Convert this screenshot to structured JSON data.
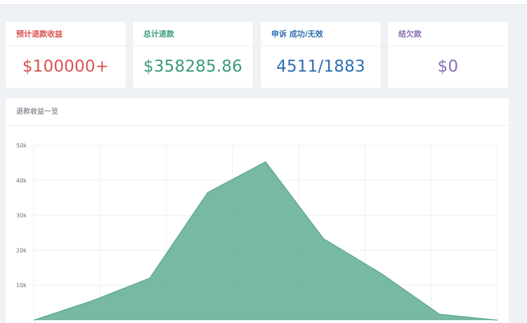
{
  "stats": [
    {
      "label": "预计退款收益",
      "value": "$100000+",
      "color": "#d9534f"
    },
    {
      "label": "总计退款",
      "value": "$358285.86",
      "color": "#3d9a78"
    },
    {
      "label": "申诉 成功/无效",
      "value": "4511/1883",
      "color": "#2f6fb0"
    },
    {
      "label": "结欠款",
      "value": "$0",
      "color": "#8a6fb0"
    }
  ],
  "chart_panel": {
    "title": "退款收益一览"
  },
  "chart_data": {
    "type": "area",
    "title": "退款收益一览",
    "x": [
      0,
      1,
      2,
      3,
      4,
      5,
      6,
      7,
      8
    ],
    "values": [
      0,
      5500,
      12000,
      36500,
      45300,
      23300,
      13300,
      1700,
      0
    ],
    "yticks": [
      "10k",
      "20k",
      "30k",
      "40k",
      "50k"
    ],
    "ylim": [
      0,
      50000
    ],
    "grid": true,
    "fill_color": "#6bb39b",
    "line_color": "#5aa88c"
  }
}
